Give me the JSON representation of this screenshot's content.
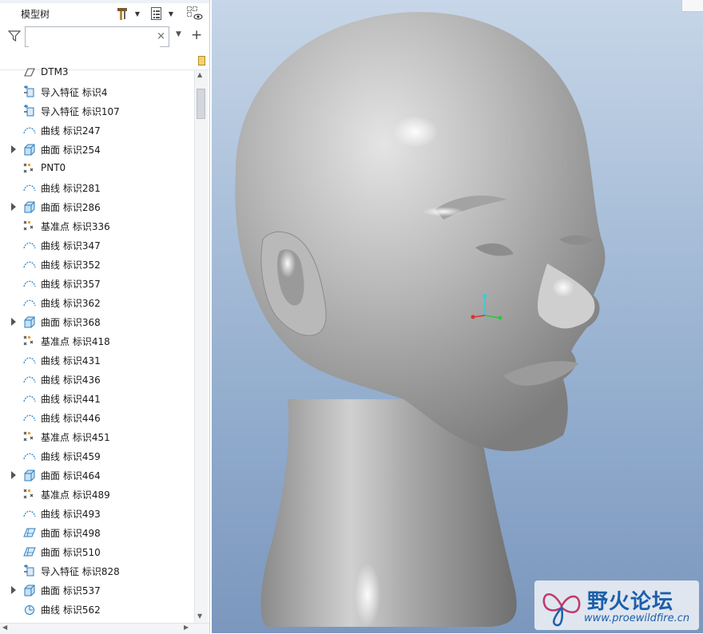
{
  "sidebar": {
    "title": "模型树",
    "search_value": "",
    "clear_glyph": "×",
    "add_glyph": "+",
    "items": [
      {
        "label": "DTM3",
        "icon": "datum-plane-icon",
        "expandable": false
      },
      {
        "label": "导入特征 标识4",
        "icon": "import-feature-icon",
        "expandable": false
      },
      {
        "label": "导入特征 标识107",
        "icon": "import-feature-icon",
        "expandable": false
      },
      {
        "label": "曲线 标识247",
        "icon": "curve-icon",
        "expandable": false
      },
      {
        "label": "曲面 标识254",
        "icon": "surface-icon",
        "expandable": true
      },
      {
        "label": "PNT0",
        "icon": "datum-point-icon",
        "expandable": false
      },
      {
        "label": "曲线 标识281",
        "icon": "curve-icon",
        "expandable": false
      },
      {
        "label": "曲面 标识286",
        "icon": "surface-icon",
        "expandable": true
      },
      {
        "label": "基准点 标识336",
        "icon": "datum-point-icon",
        "expandable": false
      },
      {
        "label": "曲线 标识347",
        "icon": "curve-icon",
        "expandable": false
      },
      {
        "label": "曲线 标识352",
        "icon": "curve-icon",
        "expandable": false
      },
      {
        "label": "曲线 标识357",
        "icon": "curve-icon",
        "expandable": false
      },
      {
        "label": "曲线 标识362",
        "icon": "curve-icon",
        "expandable": false
      },
      {
        "label": "曲面 标识368",
        "icon": "surface-icon",
        "expandable": true
      },
      {
        "label": "基准点 标识418",
        "icon": "datum-point-icon",
        "expandable": false
      },
      {
        "label": "曲线 标识431",
        "icon": "curve-icon",
        "expandable": false
      },
      {
        "label": "曲线 标识436",
        "icon": "curve-icon",
        "expandable": false
      },
      {
        "label": "曲线 标识441",
        "icon": "curve-icon",
        "expandable": false
      },
      {
        "label": "曲线 标识446",
        "icon": "curve-icon",
        "expandable": false
      },
      {
        "label": "基准点 标识451",
        "icon": "datum-point-icon",
        "expandable": false
      },
      {
        "label": "曲线 标识459",
        "icon": "curve-icon",
        "expandable": false
      },
      {
        "label": "曲面 标识464",
        "icon": "surface-icon",
        "expandable": true
      },
      {
        "label": "基准点 标识489",
        "icon": "datum-point-icon",
        "expandable": false
      },
      {
        "label": "曲线 标识493",
        "icon": "curve-icon",
        "expandable": false
      },
      {
        "label": "曲面 标识498",
        "icon": "boundary-surface-icon",
        "expandable": false
      },
      {
        "label": "曲面 标识510",
        "icon": "boundary-surface-icon",
        "expandable": false
      },
      {
        "label": "导入特征 标识828",
        "icon": "import-feature-icon",
        "expandable": false
      },
      {
        "label": "曲面 标识537",
        "icon": "surface-icon",
        "expandable": true
      },
      {
        "label": "曲线 标识562",
        "icon": "sketch-curve-icon",
        "expandable": false
      }
    ]
  },
  "watermark": {
    "title": "野火论坛",
    "url": "www.proewildfire.cn"
  },
  "colors": {
    "viewport_top": "#c7d6e8",
    "viewport_bottom": "#7c97bd",
    "icon_blue": "#2a7fc1",
    "watermark_blue": "#1d5faa"
  }
}
